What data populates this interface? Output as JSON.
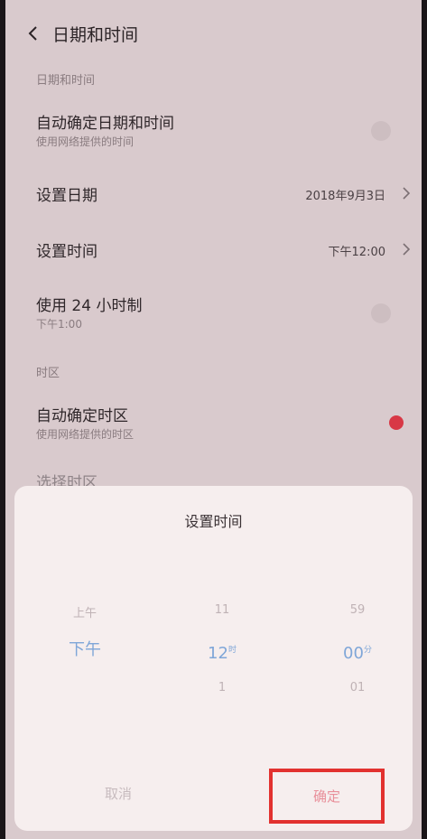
{
  "header": {
    "title": "日期和时间"
  },
  "sections": {
    "date_time": "日期和时间",
    "timezone": "时区"
  },
  "rows": {
    "auto_date_time": {
      "title": "自动确定日期和时间",
      "subtitle": "使用网络提供的时间"
    },
    "set_date": {
      "title": "设置日期",
      "value": "2018年9月3日"
    },
    "set_time": {
      "title": "设置时间",
      "value": "下午12:00"
    },
    "use_24h": {
      "title": "使用 24 小时制",
      "subtitle": "下午1:00"
    },
    "auto_timezone": {
      "title": "自动确定时区",
      "subtitle": "使用网络提供的时区"
    },
    "select_timezone": {
      "title": "选择时区"
    }
  },
  "dialog": {
    "title": "设置时间",
    "ampm": {
      "prev": "上午",
      "selected": "下午"
    },
    "hour": {
      "prev": "11",
      "selected": "12",
      "suffix": "时",
      "next": "1"
    },
    "minute": {
      "prev": "59",
      "selected": "00",
      "suffix": "分",
      "next": "01"
    },
    "cancel": "取消",
    "confirm": "确定"
  },
  "colors": {
    "accent_toggle": "#d83846",
    "highlight_box": "#e2312f",
    "picker_selected": "#7fa6d8"
  }
}
